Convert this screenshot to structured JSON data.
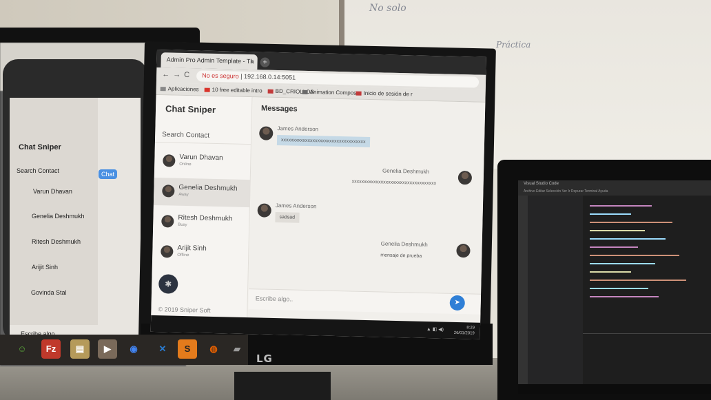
{
  "browser": {
    "tab_title": "Admin Pro Admin Template - Th",
    "tab_close": "×",
    "new_tab": "+",
    "nav_back": "←",
    "nav_forward": "→",
    "nav_reload": "C",
    "security_warning": "No es seguro",
    "url": "192.168.0.14:5051",
    "bookmarks": [
      {
        "label": "Aplicaciones",
        "color": "#888888"
      },
      {
        "label": "10 free editable intro",
        "color": "#d9342b"
      },
      {
        "label": "BD_CRIOLLOS",
        "color": "#c23a3a"
      },
      {
        "label": "Animation Compos",
        "color": "#6a6a6a"
      },
      {
        "label": "Inicio de sesión de r",
        "color": "#c23a3a"
      }
    ]
  },
  "app": {
    "brand": "Chat Sniper",
    "search_label": "Search Contact",
    "contacts": [
      {
        "name": "Varun Dhavan",
        "status": "Online"
      },
      {
        "name": "Genelia Deshmukh",
        "status": "Away"
      },
      {
        "name": "Ritesh Deshmukh",
        "status": "Busy"
      },
      {
        "name": "Arijit Sinh",
        "status": "Offline"
      }
    ],
    "fab_icon": "gear-icon",
    "fab_glyph": "✱",
    "footer": "© 2019 Sniper Soft",
    "messages_title": "Messages",
    "messages": [
      {
        "author": "James Anderson",
        "text": "xxxxxxxxxxxxxxxxxxxxxxxxxxxxxxxxxxx",
        "side": "left"
      },
      {
        "author": "Genelia Deshmukh",
        "text": "xxxxxxxxxxxxxxxxxxxxxxxxxxxxxxxxxxx",
        "side": "right"
      },
      {
        "author": "James Anderson",
        "text": "sadsad",
        "side": "left"
      },
      {
        "author": "Genelia Deshmukh",
        "text": "mensaje de prueba",
        "side": "right"
      }
    ],
    "compose_placeholder": "Escribe algo..",
    "send_icon": "send-icon",
    "send_glyph": "➤"
  },
  "taskbar": {
    "clock_time": "8:29",
    "clock_date": "26/01/2019"
  },
  "monitor_brand": "LG",
  "background_monitor": {
    "brand": "Chat Sniper",
    "search_label": "Search Contact",
    "contacts": [
      "Varun Dhavan",
      "Genelia Deshmukh",
      "Ritesh Deshmukh",
      "Arijit Sinh",
      "Govinda Stal"
    ],
    "compose_placeholder": "Escribe algo..",
    "chat_chip": "Chat"
  },
  "whiteboard": {
    "line1": "No solo",
    "line2": "Práctica"
  },
  "laptop": {
    "title": "Visual Studio Code",
    "menu": "Archivo  Editar  Selección  Ver  Ir  Depurar  Terminal  Ayuda"
  },
  "dock_apps": [
    {
      "name": "android-icon",
      "glyph": "☺",
      "color": "#5aa63a"
    },
    {
      "name": "filezilla-icon",
      "glyph": "Fz",
      "color": "#c0392b"
    },
    {
      "name": "folder-icon",
      "glyph": "▤",
      "color": "#b59a5a"
    },
    {
      "name": "media-player-icon",
      "glyph": "▶",
      "color": "#7a6a5a"
    },
    {
      "name": "chrome-icon",
      "glyph": "◉",
      "color": "#4285f4"
    },
    {
      "name": "vscode-icon",
      "glyph": "✕",
      "color": "#2a7bd0"
    },
    {
      "name": "sublime-icon",
      "glyph": "S",
      "color": "#e37b1c"
    },
    {
      "name": "firefox-icon",
      "glyph": "◍",
      "color": "#e66000"
    },
    {
      "name": "files-icon",
      "glyph": "▰",
      "color": "#9a9a9a"
    }
  ]
}
